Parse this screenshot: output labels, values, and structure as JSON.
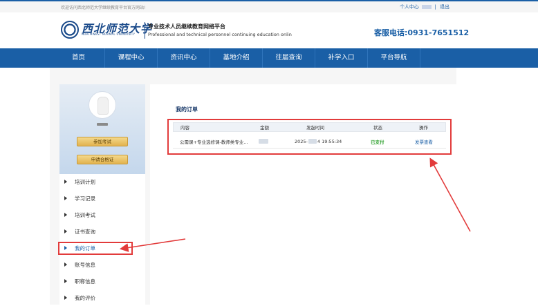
{
  "topbar": {
    "welcome": "欢迎访问西北师范大学继续教育平台官方网站!",
    "personal_center": "个人中心",
    "separator": "|",
    "logout": "退出"
  },
  "header": {
    "logo_calligraphy": "西北师范大学",
    "logo_english": "NORTHWEST NORMAL UNIVERSITY",
    "platform_name": "专业技术人员继续教育网络平台",
    "platform_english": "Professional and technical personnel continuing education onlin",
    "hotline": "客服电话:0931-7651512"
  },
  "nav": {
    "items": [
      {
        "label": "首页"
      },
      {
        "label": "课程中心"
      },
      {
        "label": "资讯中心"
      },
      {
        "label": "基地介绍"
      },
      {
        "label": "往届查询"
      },
      {
        "label": "补学入口"
      },
      {
        "label": "平台导航"
      }
    ]
  },
  "sidebar": {
    "exam_button": "参加考试",
    "certificate_button": "申请合格证",
    "menu": [
      {
        "label": "培训计划"
      },
      {
        "label": "学习记录"
      },
      {
        "label": "培训考试"
      },
      {
        "label": "证书查询"
      },
      {
        "label": "我的订单"
      },
      {
        "label": "账号信息"
      },
      {
        "label": "职称信息"
      },
      {
        "label": "我的评价"
      }
    ],
    "active_item": "我的订单"
  },
  "orders": {
    "title": "我的订单",
    "columns": [
      "内容",
      "金额",
      "发起时间",
      "状态",
      "操作"
    ],
    "rows": [
      {
        "content": "公需课+专业选修课-教师类专业…",
        "date_prefix": "2025-",
        "date_suffix": "4 19:55:34",
        "status": "已支付",
        "action": "发票查看"
      }
    ]
  },
  "annotations": {
    "highlight_color": "#e23b3b"
  },
  "icons": {
    "menu_bullet": "triangle-right-icon"
  },
  "colors": {
    "brand_blue": "#1a5fa6",
    "status_paid": "#2ea02e",
    "button_gold": "#e2b24e"
  }
}
